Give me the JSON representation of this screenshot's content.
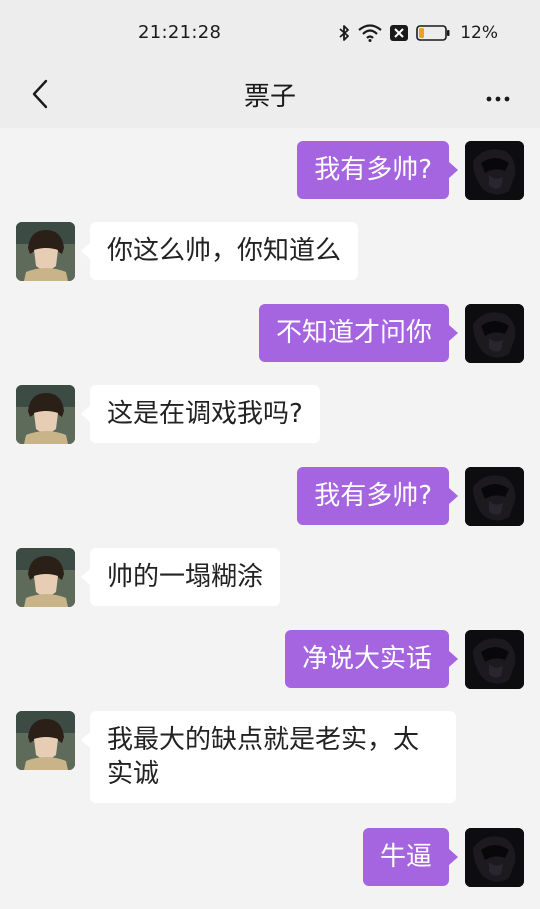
{
  "status_bar": {
    "time": "21:21:28",
    "battery_percent": "12%",
    "icons": [
      "bluetooth-icon",
      "wifi-icon",
      "no-sim-icon",
      "battery-icon"
    ]
  },
  "header": {
    "title": "票子",
    "back_icon": "chevron-left-icon",
    "more_icon": "more-dots-icon"
  },
  "colors": {
    "outgoing_bubble": "#a564e0",
    "incoming_bubble": "#ffffff",
    "background": "#f3f3f4",
    "header_bg": "#ededed"
  },
  "messages": [
    {
      "side": "right",
      "text": "我有多帅?"
    },
    {
      "side": "left",
      "text": "你这么帅，你知道么"
    },
    {
      "side": "right",
      "text": "不知道才问你"
    },
    {
      "side": "left",
      "text": "这是在调戏我吗?"
    },
    {
      "side": "right",
      "text": "我有多帅?"
    },
    {
      "side": "left",
      "text": "帅的一塌糊涂"
    },
    {
      "side": "right",
      "text": "净说大实话"
    },
    {
      "side": "left",
      "text": "我最大的缺点就是老实，太实诚"
    },
    {
      "side": "right",
      "text": "牛逼"
    }
  ]
}
